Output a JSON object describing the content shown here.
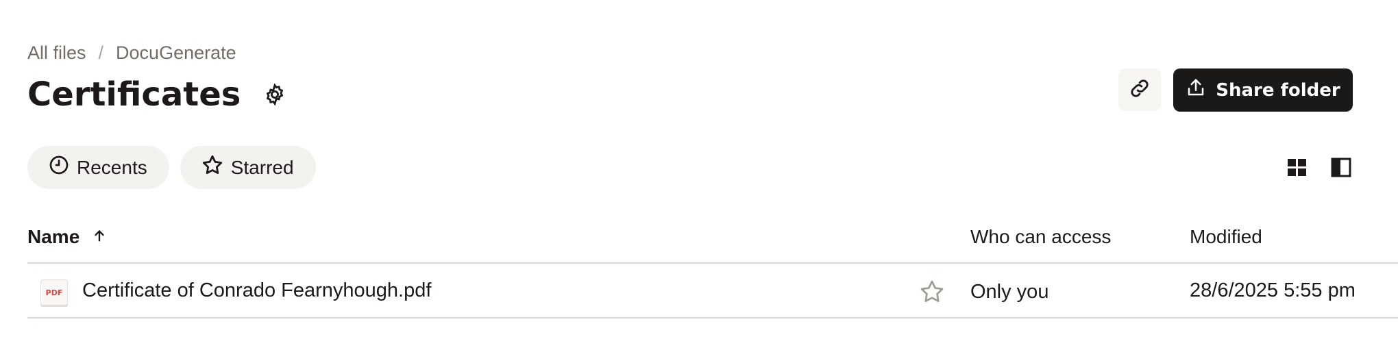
{
  "breadcrumb": {
    "root": "All files",
    "separator": "/",
    "current": "DocuGenerate"
  },
  "page": {
    "title": "Certificates",
    "settings_icon": "gear-icon"
  },
  "actions": {
    "copy_link_icon": "link-icon",
    "share_label": "Share folder",
    "share_icon": "share-icon"
  },
  "chips": [
    {
      "label": "Recents",
      "icon": "clock-icon"
    },
    {
      "label": "Starred",
      "icon": "star-icon"
    }
  ],
  "view_controls": {
    "grid_icon": "grid-view-icon",
    "panel_icon": "side-panel-icon"
  },
  "table": {
    "columns": {
      "name": "Name",
      "access": "Who can access",
      "modified": "Modified"
    },
    "sort": {
      "column": "name",
      "direction": "ascending"
    },
    "rows": [
      {
        "type_badge": "PDF",
        "name": "Certificate of Conrado Fearnyhough.pdf",
        "access": "Only you",
        "modified": "28/6/2025 5:55 pm",
        "starred": false
      }
    ]
  },
  "colors": {
    "primary_button": "#1a1918",
    "chip_bg": "#f4f2ef",
    "pdf_badge": "#e0433a",
    "muted_text": "#736c64"
  }
}
